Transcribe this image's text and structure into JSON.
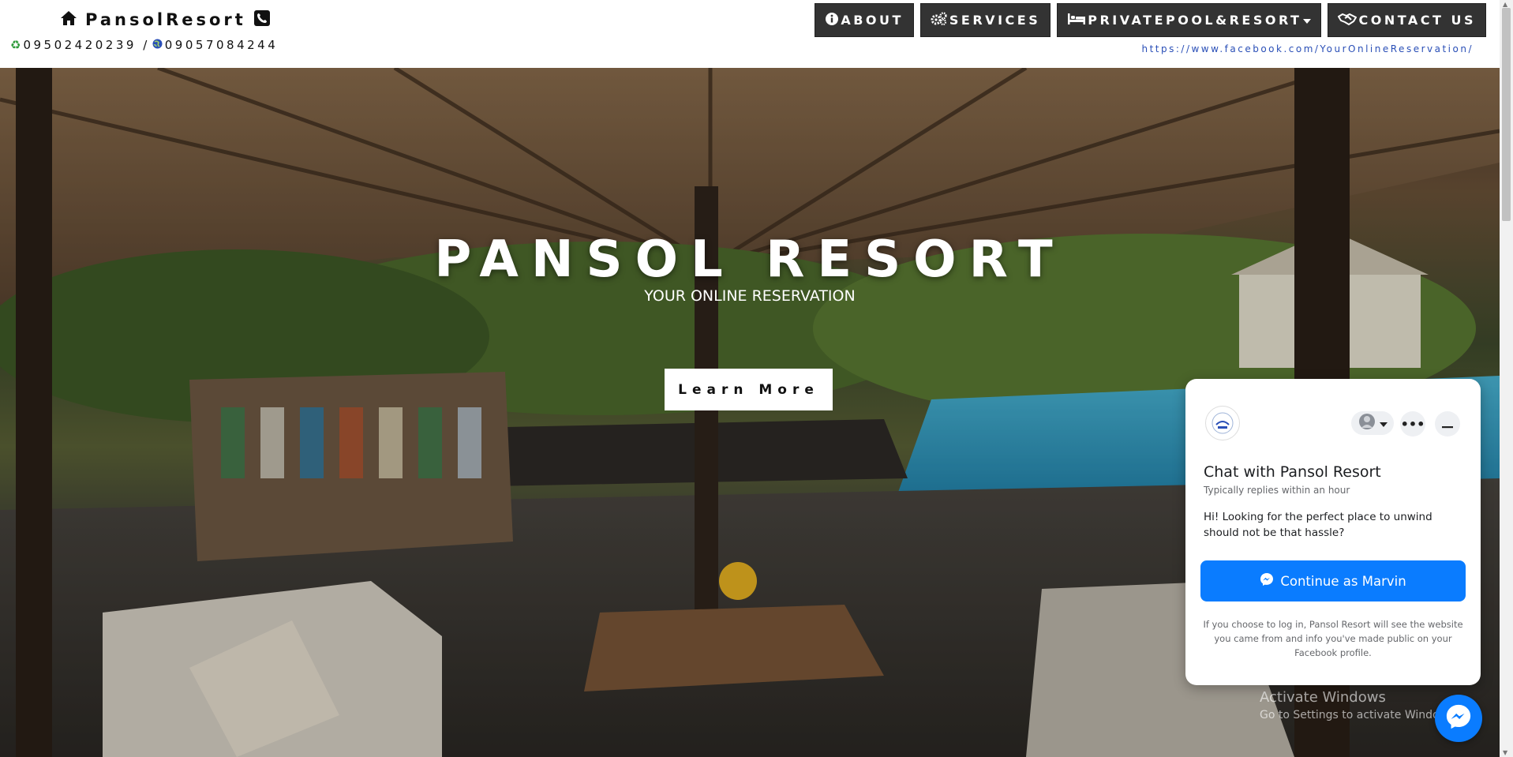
{
  "header": {
    "brand_name": "PansolResort",
    "phone_1": "09502420239 /",
    "phone_2": "09057084244",
    "fb_link": "https://www.facebook.com/YourOnlineReservation/"
  },
  "nav": {
    "about": "ABOUT",
    "services": "SERVICES",
    "private_pool": "PRIVATEPOOL&RESORT",
    "contact": "CONTACT US"
  },
  "hero": {
    "title": "PANSOL RESORT",
    "subtitle": "YOUR ONLINE RESERVATION",
    "cta": "Learn More"
  },
  "chat": {
    "title": "Chat with Pansol Resort",
    "reply_time": "Typically replies within an hour",
    "message": "Hi! Looking for the perfect place to unwind should not be that hassle?",
    "cta": "Continue as Marvin",
    "footer": "If you choose to log in, Pansol Resort will see the website you came from and info you've made public on your Facebook profile."
  },
  "watermark": {
    "line1": "Activate Windows",
    "line2": "Go to Settings to activate Windows."
  },
  "colors": {
    "nav_bg": "#333333",
    "link_blue": "#2a4fb7",
    "messenger_blue": "#0a7cff"
  },
  "icons": {
    "home": "home-icon",
    "phone": "phone-icon",
    "recycle": "recycle-icon",
    "globe": "globe-icon",
    "info": "info-icon",
    "gears": "gears-icon",
    "bed": "bed-icon",
    "handshake": "handshake-icon",
    "messenger": "messenger-icon"
  }
}
